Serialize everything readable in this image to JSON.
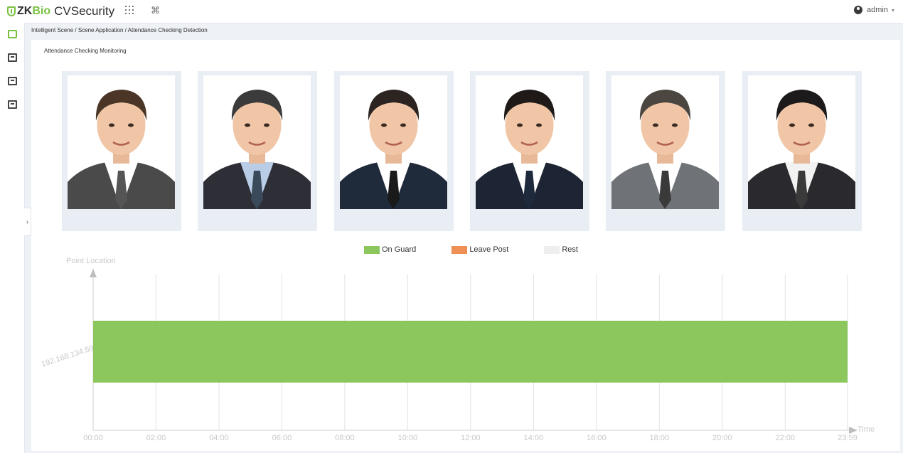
{
  "header": {
    "logo_zk": "ZK",
    "logo_bio": "Bio",
    "logo_product": "CVSecurity",
    "apps_icon": "apps-grid-icon",
    "shortcut_icon": "command-icon",
    "user_name": "admin",
    "user_icon": "user-circle-icon"
  },
  "sidebar": {
    "items": [
      {
        "icon": "scene-icon",
        "color": "#7ac142"
      },
      {
        "icon": "device-icon",
        "color": "#444444"
      },
      {
        "icon": "printer-icon",
        "color": "#444444"
      },
      {
        "icon": "report-icon",
        "color": "#444444"
      }
    ],
    "collapse_label": "›"
  },
  "breadcrumb": "Intelligent Scene / Scene Application / Attendance Checking Detection",
  "panel_title": "Attendance Checking Monitoring",
  "photos": [
    {
      "name": "person-1",
      "suit": "#4a4a4a",
      "tie": "#555555",
      "hair": "#4a3526",
      "shirt": "#ffffff"
    },
    {
      "name": "person-2",
      "suit": "#2e2e36",
      "tie": "#3a4a5a",
      "hair": "#3b3b3b",
      "shirt": "#b9cde6"
    },
    {
      "name": "person-3",
      "suit": "#1f2a3a",
      "tie": "#1a1a1a",
      "hair": "#2b2420",
      "shirt": "#ffffff"
    },
    {
      "name": "person-4",
      "suit": "#1d2433",
      "tie": "#1e2a3c",
      "hair": "#1f1a18",
      "shirt": "#ffffff"
    },
    {
      "name": "person-5",
      "suit": "#6f7378",
      "tie": "#3a3a3a",
      "hair": "#4c4640",
      "shirt": "#ffffff"
    },
    {
      "name": "person-6",
      "suit": "#2a2a2e",
      "tie": "#3a3a3a",
      "hair": "#1c1a1a",
      "shirt": "#f2f2f2"
    }
  ],
  "legend": [
    {
      "label": "On Guard",
      "color": "#8cc75e"
    },
    {
      "label": "Leave Post",
      "color": "#ef8e55"
    },
    {
      "label": "Rest",
      "color": "#eeeeee"
    }
  ],
  "chart_data": {
    "type": "bar",
    "orientation": "horizontal-timeline",
    "ylabel": "Point Location",
    "xlabel": "Time",
    "categories": [
      "192.168.134.59"
    ],
    "x_ticks": [
      "00:00",
      "02:00",
      "04:00",
      "06:00",
      "08:00",
      "10:00",
      "12:00",
      "14:00",
      "16:00",
      "18:00",
      "20:00",
      "22:00",
      "23:59"
    ],
    "xlim": [
      "00:00",
      "23:59"
    ],
    "grid": true,
    "series": [
      {
        "name": "On Guard",
        "color": "#8cc75e",
        "segments": [
          {
            "category": "192.168.134.59",
            "start": "00:00",
            "end": "23:59"
          }
        ]
      },
      {
        "name": "Leave Post",
        "color": "#ef8e55",
        "segments": []
      },
      {
        "name": "Rest",
        "color": "#eeeeee",
        "segments": []
      }
    ]
  }
}
